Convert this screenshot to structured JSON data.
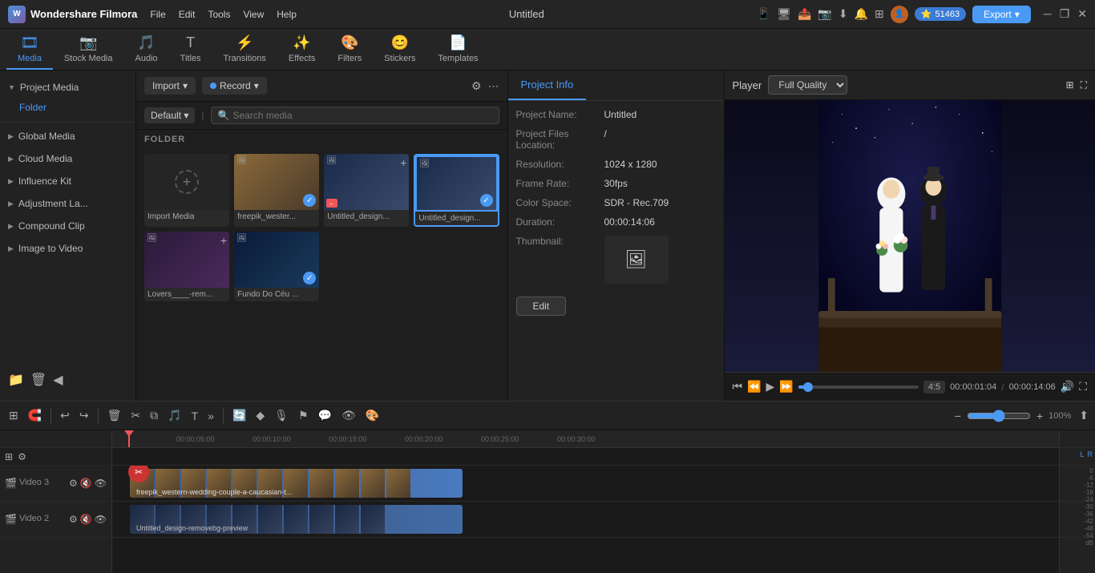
{
  "app": {
    "name": "Wondershare Filmora",
    "title": "Untitled",
    "logo_text": "W"
  },
  "menu": {
    "items": [
      "File",
      "Edit",
      "Tools",
      "View",
      "Help"
    ]
  },
  "topbar": {
    "points": "51463",
    "export_label": "Export"
  },
  "toolbar": {
    "tabs": [
      {
        "id": "media",
        "label": "Media",
        "icon": "🎞"
      },
      {
        "id": "stock",
        "label": "Stock Media",
        "icon": "📷"
      },
      {
        "id": "audio",
        "label": "Audio",
        "icon": "🎵"
      },
      {
        "id": "titles",
        "label": "Titles",
        "icon": "T"
      },
      {
        "id": "transitions",
        "label": "Transitions",
        "icon": "⚡"
      },
      {
        "id": "effects",
        "label": "Effects",
        "icon": "✨"
      },
      {
        "id": "filters",
        "label": "Filters",
        "icon": "🎨"
      },
      {
        "id": "stickers",
        "label": "Stickers",
        "icon": "😊"
      },
      {
        "id": "templates",
        "label": "Templates",
        "icon": "📄"
      }
    ],
    "active": "media"
  },
  "left_panel": {
    "sections": [
      {
        "id": "project-media",
        "label": "Project Media",
        "expanded": true
      },
      {
        "id": "folder",
        "label": "Folder",
        "sub": true
      },
      {
        "id": "global-media",
        "label": "Global Media",
        "expanded": false
      },
      {
        "id": "cloud-media",
        "label": "Cloud Media",
        "expanded": false
      },
      {
        "id": "influence-kit",
        "label": "Influence Kit",
        "expanded": false
      },
      {
        "id": "adjustment-la",
        "label": "Adjustment La...",
        "expanded": false
      },
      {
        "id": "compound-clip",
        "label": "Compound Clip",
        "expanded": false
      },
      {
        "id": "image-to-video",
        "label": "Image to Video",
        "expanded": false
      }
    ]
  },
  "media_panel": {
    "import_label": "Import",
    "record_label": "Record",
    "default_label": "Default",
    "search_placeholder": "Search media",
    "folder_label": "FOLDER",
    "items": [
      {
        "id": "import",
        "type": "import",
        "name": "Import Media",
        "thumb": "import"
      },
      {
        "id": "freepik",
        "type": "video",
        "name": "freepik_wester...",
        "thumb": "wedding",
        "checked": true
      },
      {
        "id": "untitled1",
        "type": "video",
        "name": "Untitled_design...",
        "thumb": "design",
        "checked": false,
        "has_plus": true
      },
      {
        "id": "untitled2",
        "type": "video",
        "name": "Untitled_design...",
        "thumb": "design2",
        "checked": true,
        "selected": true
      },
      {
        "id": "lovers",
        "type": "video",
        "name": "Lovers____-rem...",
        "thumb": "lover",
        "checked": false,
        "has_plus": true
      },
      {
        "id": "fundo",
        "type": "video",
        "name": "Fundo Do Céu ...",
        "thumb": "sky",
        "checked": true
      }
    ]
  },
  "project_info": {
    "tab_label": "Project Info",
    "fields": {
      "project_name_label": "Project Name:",
      "project_name_value": "Untitled",
      "files_location_label": "Project Files Location:",
      "files_location_value": "/",
      "resolution_label": "Resolution:",
      "resolution_value": "1024 x 1280",
      "frame_rate_label": "Frame Rate:",
      "frame_rate_value": "30fps",
      "color_space_label": "Color Space:",
      "color_space_value": "SDR - Rec.709",
      "duration_label": "Duration:",
      "duration_value": "00:00:14:06",
      "thumbnail_label": "Thumbnail:"
    },
    "edit_button": "Edit"
  },
  "player": {
    "label": "Player",
    "quality": "Full Quality",
    "current_time": "00:00:01:04",
    "total_time": "00:00:14:06",
    "ratio": "4:5"
  },
  "timeline": {
    "tracks": [
      {
        "id": "video3",
        "label": "Video 3",
        "clip": "freepik_western-wedding-couple-a-caucasian-t..."
      },
      {
        "id": "video2",
        "label": "Video 2",
        "clip": "Untitled_design-removebg-preview"
      }
    ],
    "time_marks": [
      "00:00:05:00",
      "00:00:10:00",
      "00:00:15:00",
      "00:00:20:00",
      "00:00:25:00",
      "00:00:30:00"
    ],
    "db_marks": [
      "0",
      "-6",
      "-12",
      "-18",
      "-24",
      "-30",
      "-36",
      "-42",
      "-48",
      "-54",
      "dB"
    ]
  }
}
